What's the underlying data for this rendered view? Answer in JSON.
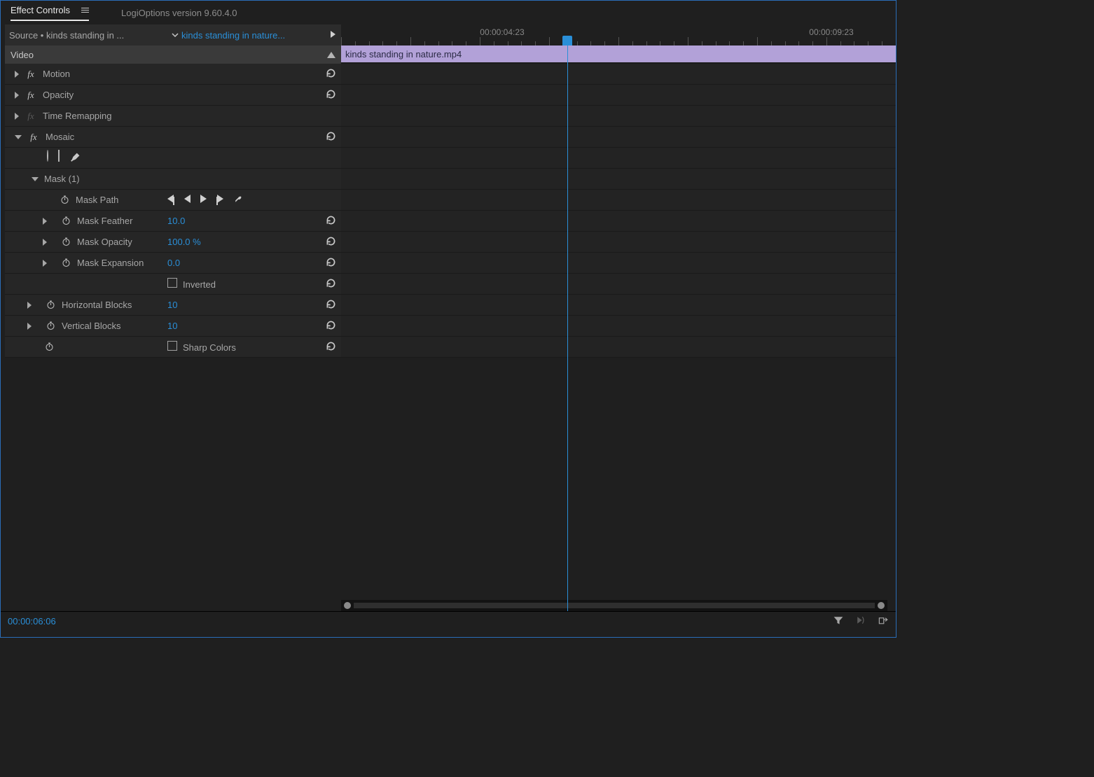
{
  "tabs": {
    "active": "Effect Controls",
    "secondary": "LogiOptions version 9.60.4.0"
  },
  "source": {
    "left": "Source • kinds standing in ...",
    "right": "kinds standing in nature..."
  },
  "section_header": "Video",
  "effects": {
    "motion": "Motion",
    "opacity": "Opacity",
    "time_remap": "Time Remapping",
    "mosaic": {
      "label": "Mosaic",
      "mask": {
        "label": "Mask (1)",
        "path": "Mask Path",
        "feather": {
          "label": "Mask Feather",
          "value": "10.0"
        },
        "opacity": {
          "label": "Mask Opacity",
          "value": "100.0 %"
        },
        "expansion": {
          "label": "Mask Expansion",
          "value": "0.0"
        },
        "inverted": "Inverted"
      },
      "hblocks": {
        "label": "Horizontal Blocks",
        "value": "10"
      },
      "vblocks": {
        "label": "Vertical Blocks",
        "value": "10"
      },
      "sharp": "Sharp Colors"
    }
  },
  "ruler": {
    "t1": "00:00:04:23",
    "t2": "00:00:09:23"
  },
  "clip_name": "kinds standing in nature.mp4",
  "footer_timecode": "00:00:06:06"
}
